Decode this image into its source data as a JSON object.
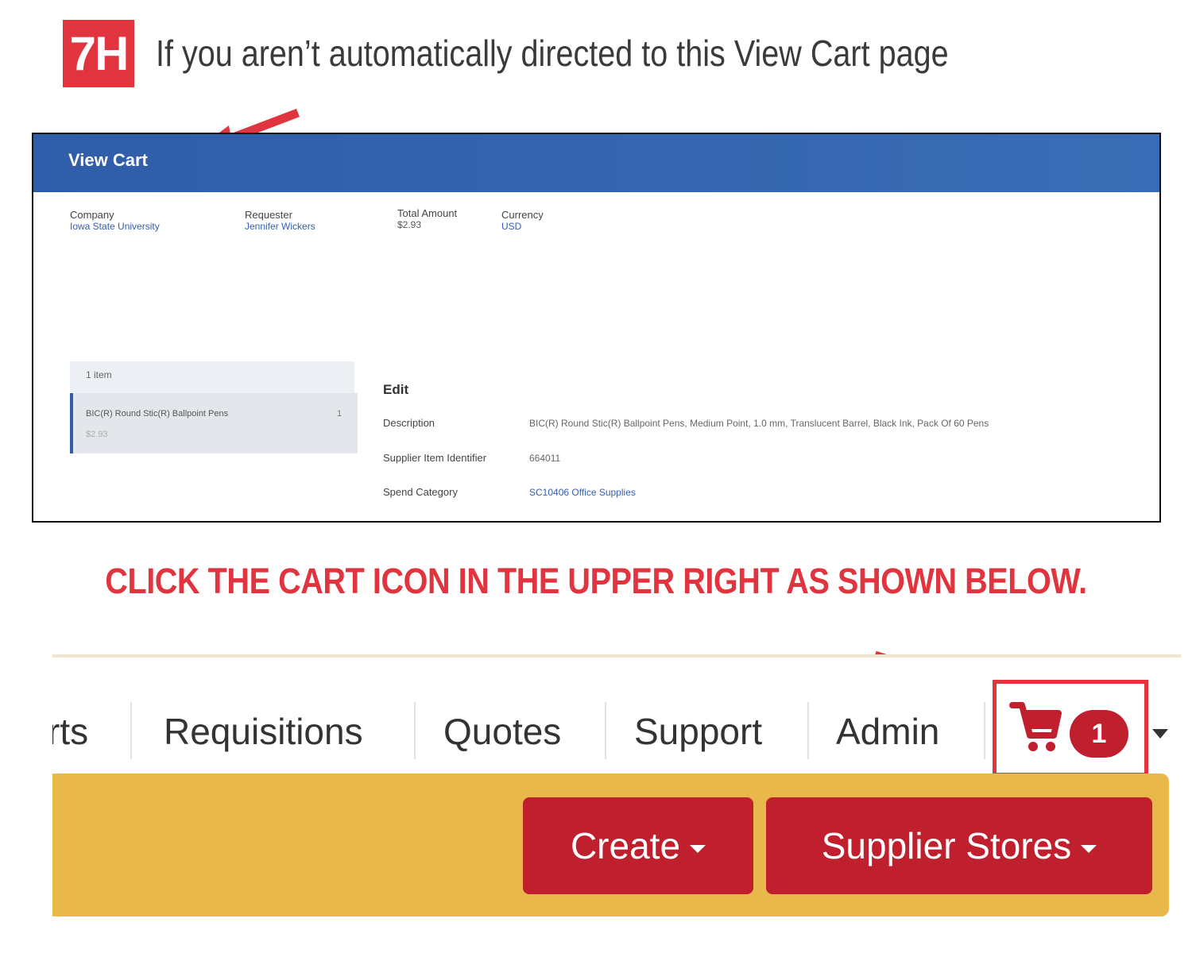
{
  "step": {
    "badge": "7H",
    "text": "If you aren’t automatically directed to this View Cart page"
  },
  "view_cart": {
    "title": "View Cart",
    "meta": [
      {
        "label": "Company",
        "value": "Iowa State University"
      },
      {
        "label": "Requester",
        "value": "Jennifer Wickers"
      },
      {
        "label": "Total Amount",
        "value": "$2.93"
      },
      {
        "label": "Currency",
        "value": "USD"
      }
    ],
    "items_count": "1 item",
    "item": {
      "name": "BIC(R) Round Stic(R) Ballpoint Pens",
      "qty": "1",
      "price": "$2.93"
    },
    "edit": {
      "title": "Edit",
      "fields": [
        {
          "label": "Description",
          "value": "BIC(R) Round Stic(R) Ballpoint Pens, Medium Point, 1.0 mm, Translucent Barrel, Black Ink, Pack Of 60 Pens"
        },
        {
          "label": "Supplier Item Identifier",
          "value": "664011"
        },
        {
          "label": "Spend Category",
          "value": "SC10406 Office Supplies"
        }
      ]
    }
  },
  "instruction": "CLICK THE CART ICON IN THE UPPER RIGHT AS SHOWN BELOW.",
  "nav": {
    "items": [
      "rts",
      "Requisitions",
      "Quotes",
      "Support",
      "Admin"
    ],
    "cart_count": "1",
    "buttons": {
      "create": "Create",
      "supplier_stores": "Supplier Stores"
    }
  },
  "colors": {
    "accent_red": "#e0343f",
    "button_red": "#c01f2e",
    "header_blue": "#2f5da8",
    "toolbar_yellow": "#e8b84b"
  }
}
